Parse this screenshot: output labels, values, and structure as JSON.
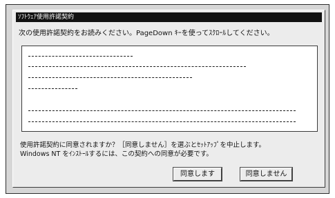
{
  "dialog": {
    "title": "ｿﾌﾄｳｪｱ使用許諾契約",
    "instruction": "次の使用許諾契約をお読みください。PageDown ｷｰを使ってｽｸﾛｰﾙしてください。",
    "question_line1": "使用許諾契約に同意されますか？［同意しません］を選ぶとｾｯﾄｱｯﾌﾟを中止します。",
    "question_line2": "Windows NT をｲﾝｽﾄｰﾙするには、この契約への同意が必要です。",
    "agree_label": "同意します",
    "disagree_label": "同意しません"
  },
  "license_text": {
    "paragraph_count": 2,
    "placeholder_lines": 6
  }
}
